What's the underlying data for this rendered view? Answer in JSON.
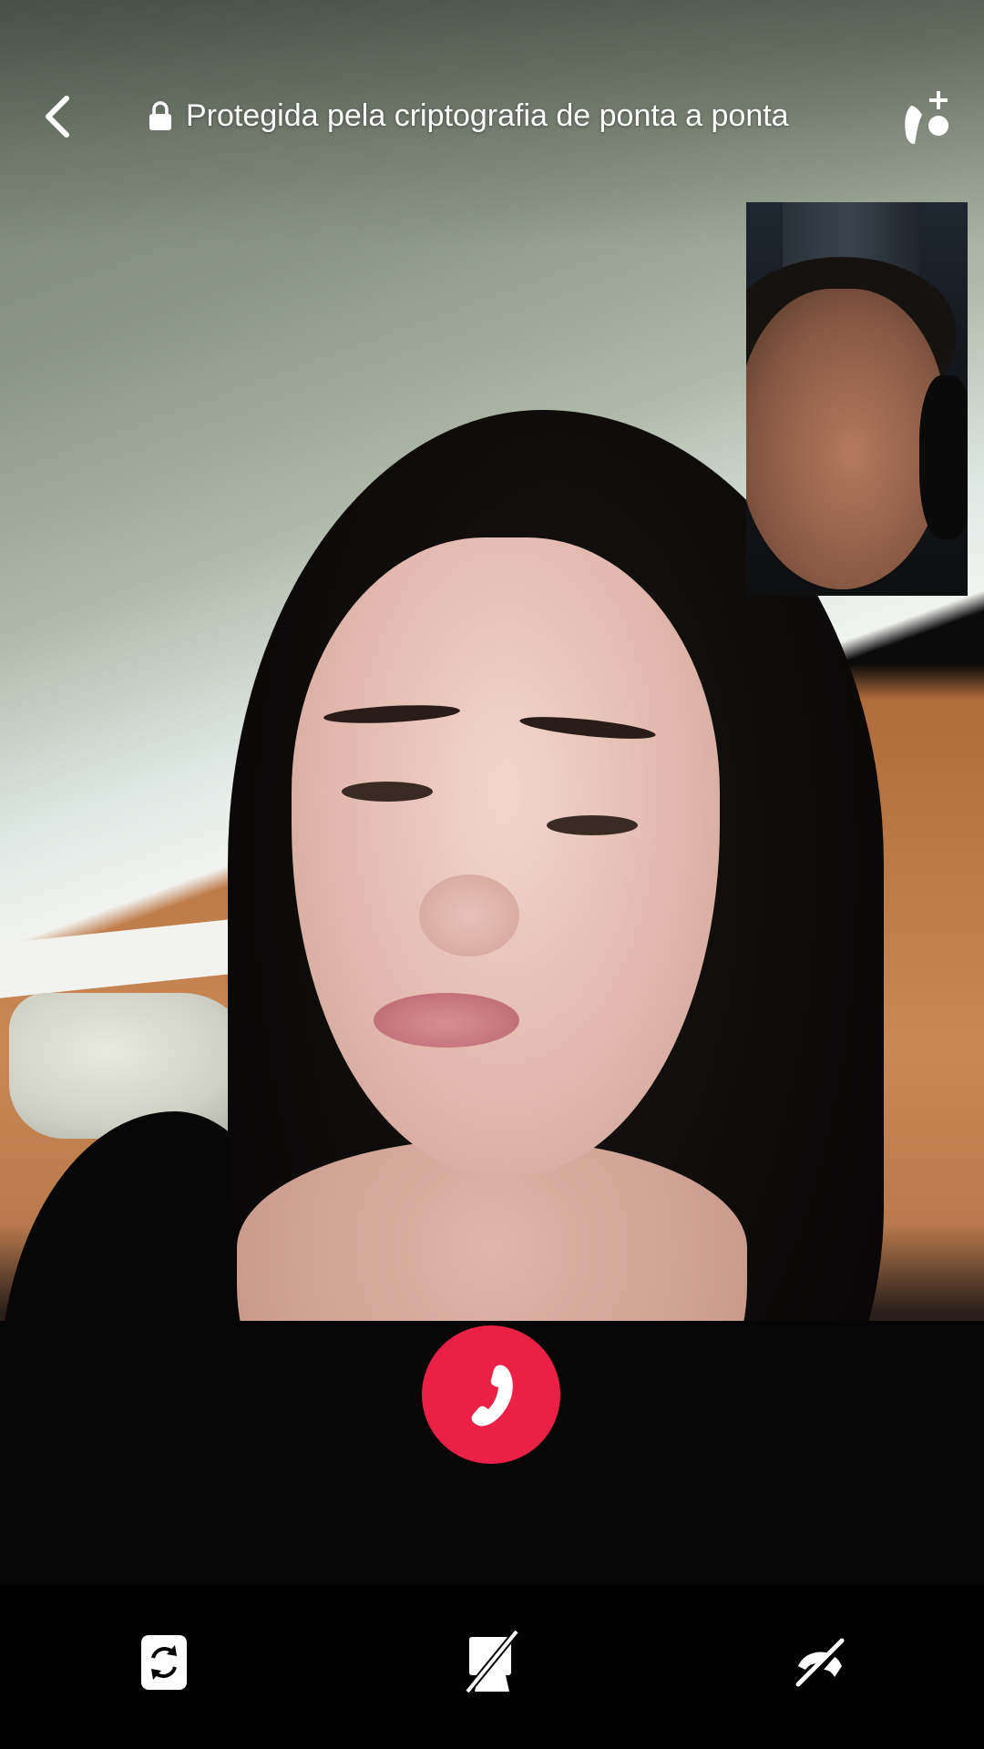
{
  "header": {
    "encryption_text": "Protegida pela criptografia de ponta a ponta"
  },
  "icons": {
    "back": "chevron-left-icon",
    "lock": "lock-icon",
    "add_participant": "person-add-icon",
    "end_call": "phone-hangup-icon",
    "switch_camera": "switch-camera-icon",
    "camera_off": "video-off-icon",
    "mute": "mic-off-icon"
  },
  "colors": {
    "end_call": "#ea2046",
    "icon": "#ffffff"
  }
}
